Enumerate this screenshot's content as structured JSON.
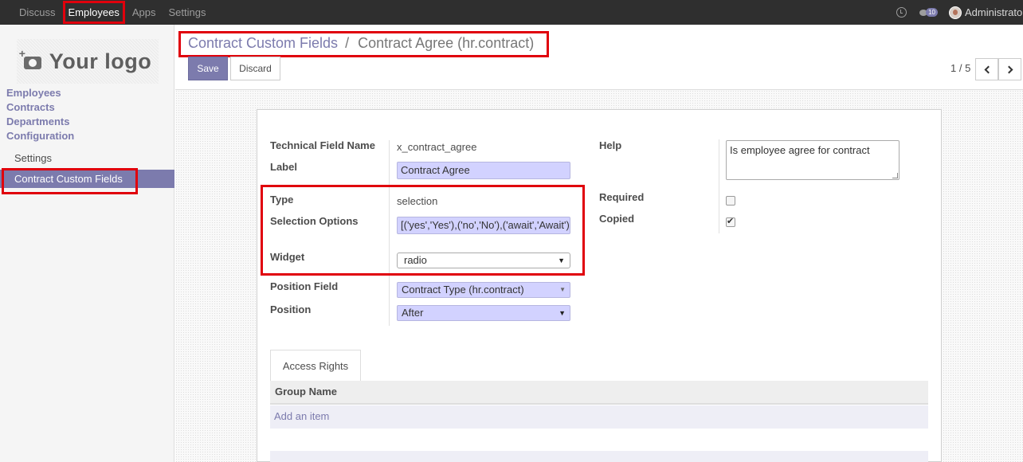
{
  "topbar": {
    "menu": [
      "Discuss",
      "Employees",
      "Apps",
      "Settings"
    ],
    "active_menu": "Employees",
    "chat_count": "10",
    "user_name": "Administrator"
  },
  "sidebar": {
    "logo_text": "Your logo",
    "sections": [
      "Employees",
      "Contracts",
      "Departments",
      "Configuration"
    ],
    "sub_items": [
      "Settings",
      "Contract Custom Fields"
    ],
    "active_item": "Contract Custom Fields"
  },
  "control_panel": {
    "breadcrumb_parent": "Contract Custom Fields",
    "breadcrumb_separator": "/",
    "breadcrumb_current": "Contract Agree (hr.contract)",
    "save_label": "Save",
    "discard_label": "Discard",
    "pager": "1 / 5"
  },
  "form": {
    "technical_field_name_label": "Technical Field Name",
    "technical_field_name": "x_contract_agree",
    "label_label": "Label",
    "label_value": "Contract Agree",
    "type_label": "Type",
    "type_value": "selection",
    "selection_options_label": "Selection Options",
    "selection_options_value": "[('yes','Yes'),('no','No'),('await','Await')]",
    "widget_label": "Widget",
    "widget_value": "radio",
    "position_field_label": "Position Field",
    "position_field_value": "Contract Type (hr.contract)",
    "position_label": "Position",
    "position_value": "After",
    "help_label": "Help",
    "help_value": "Is employee agree for contract",
    "required_label": "Required",
    "required_checked": false,
    "copied_label": "Copied",
    "copied_checked": true
  },
  "notebook": {
    "tab_label": "Access Rights",
    "column_header": "Group Name",
    "add_item_label": "Add an item"
  },
  "colors": {
    "accent": "#7c7bad",
    "highlight_box": "#e0000c",
    "navbar": "#2f2f2f",
    "required_field_bg": "#d2d2ff"
  }
}
